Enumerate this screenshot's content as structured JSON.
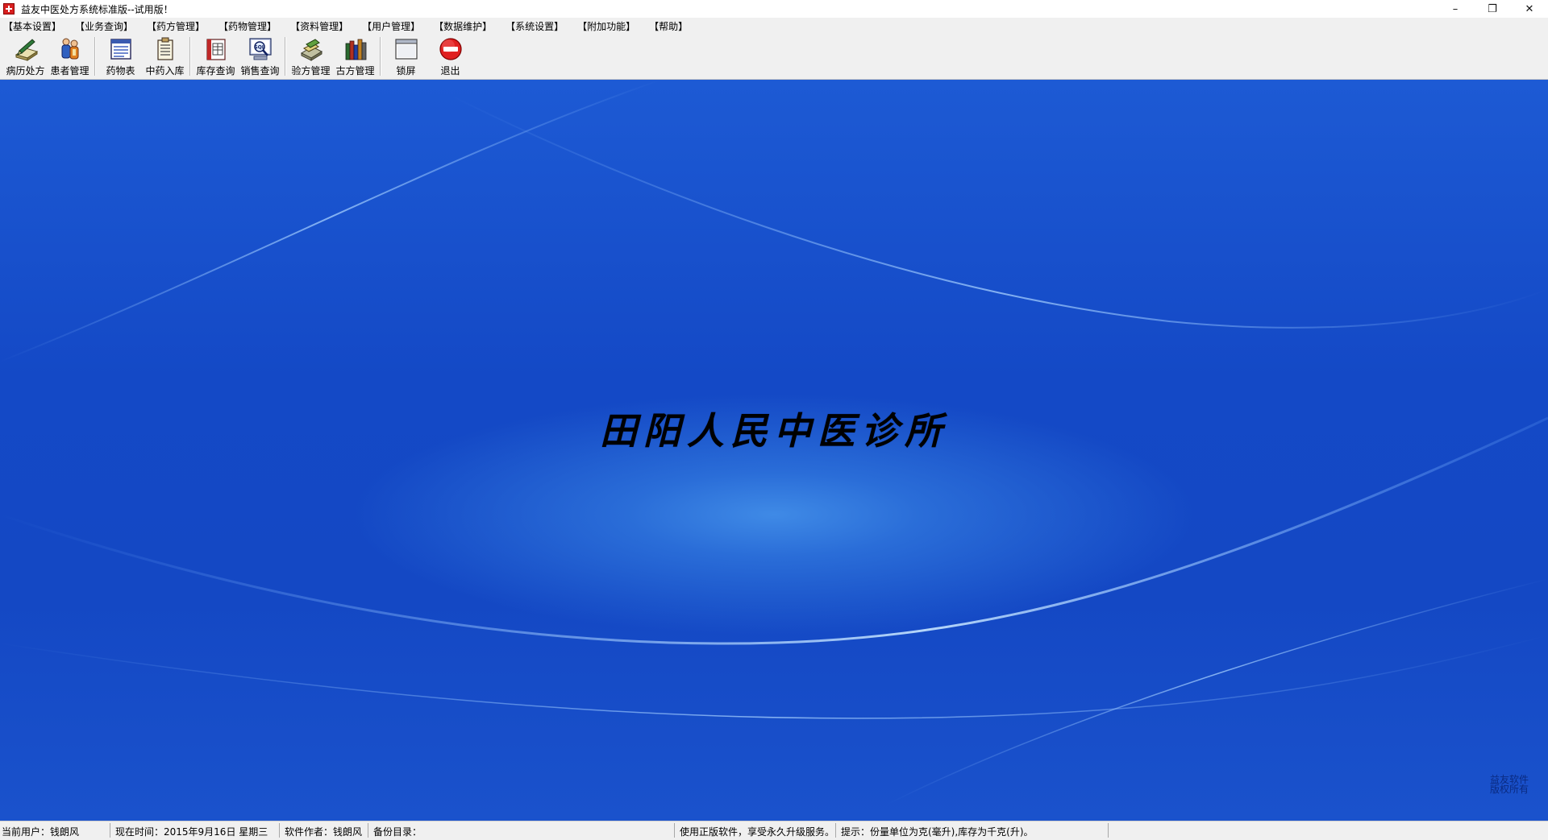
{
  "window": {
    "title": "益友中医处方系统标准版--试用版！",
    "controls": {
      "minimize": "–",
      "restore": "❐",
      "close": "✕"
    }
  },
  "menu": {
    "items": [
      "【基本设置】",
      "【业务查询】",
      "【药方管理】",
      "【药物管理】",
      "【资料管理】",
      "【用户管理】",
      "【数据维护】",
      "【系统设置】",
      "【附加功能】",
      "【帮助】"
    ]
  },
  "toolbar": {
    "buttons": [
      {
        "label": "病历处方",
        "icon": "prescription-pen-icon"
      },
      {
        "label": "患者管理",
        "icon": "patients-icon"
      },
      {
        "label": "药物表",
        "icon": "drug-table-icon"
      },
      {
        "label": "中药入库",
        "icon": "herb-stock-in-icon"
      },
      {
        "label": "库存查询",
        "icon": "inventory-book-icon"
      },
      {
        "label": "销售查询",
        "icon": "sql-query-icon"
      },
      {
        "label": "验方管理",
        "icon": "proven-recipe-icon"
      },
      {
        "label": "古方管理",
        "icon": "ancient-recipe-books-icon"
      },
      {
        "label": "锁屏",
        "icon": "lock-screen-icon"
      },
      {
        "label": "退出",
        "icon": "exit-stop-icon"
      }
    ]
  },
  "main": {
    "clinic_name": "田阳人民中医诊所",
    "watermark_line1": "益友软件",
    "watermark_line2": "版权所有",
    "colors": {
      "background": "#1449c6",
      "highlight": "#3f8ae6"
    }
  },
  "status": {
    "user": "当前用户：钱朗风",
    "time": "现在时间：2015年9月16日   星期三",
    "author": "软件作者：钱朗风",
    "backup": "备份目录：",
    "promo": "使用正版软件，享受永久升级服务。",
    "hint": "提示：份量单位为克(毫升),库存为千克(升)。"
  }
}
